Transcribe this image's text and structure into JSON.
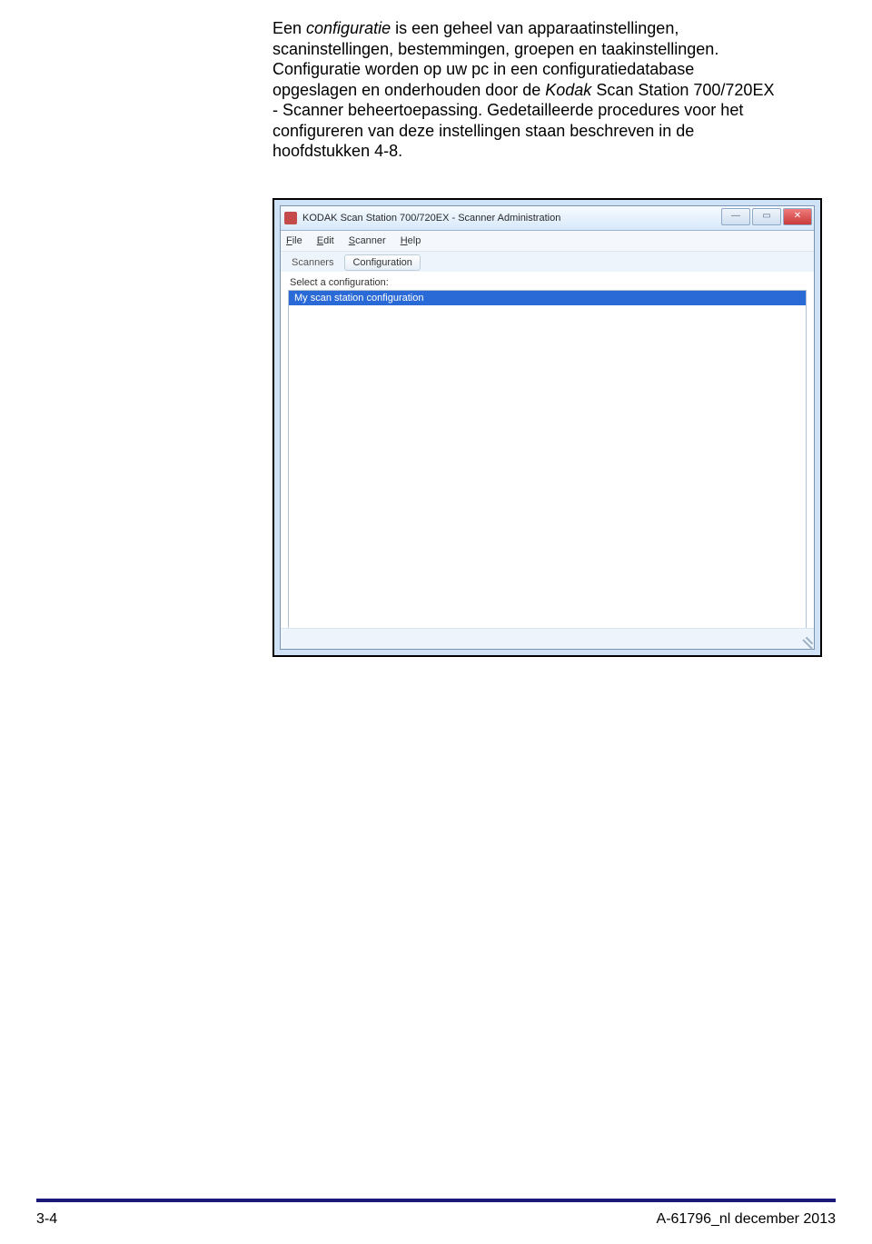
{
  "body": {
    "p1a": "Een ",
    "p1b": "configuratie",
    "p1c": " is een geheel van apparaatinstellingen, scaninstellingen, bestemmingen, groepen en taakinstellingen. Configuratie worden op uw pc in een configuratiedatabase opgeslagen en onderhouden door de ",
    "p1d": "Kodak",
    "p1e": " Scan Station 700/720EX - Scanner beheertoepassing. Gedetailleerde procedures voor het configureren van deze instellingen staan beschreven in de hoofdstukken 4-8."
  },
  "app": {
    "title": "KODAK Scan Station 700/720EX - Scanner Administration",
    "menu": {
      "file": "File",
      "edit": "Edit",
      "scanner": "Scanner",
      "help": "Help"
    },
    "toolbar": {
      "scanners": "Scanners",
      "configuration": "Configuration"
    },
    "select_label": "Select a configuration:",
    "list_item": "My scan station configuration",
    "win_controls": {
      "min": "—",
      "max": "▭",
      "close": "✕"
    }
  },
  "footer": {
    "left": "3-4",
    "right": "A-61796_nl  december 2013"
  }
}
